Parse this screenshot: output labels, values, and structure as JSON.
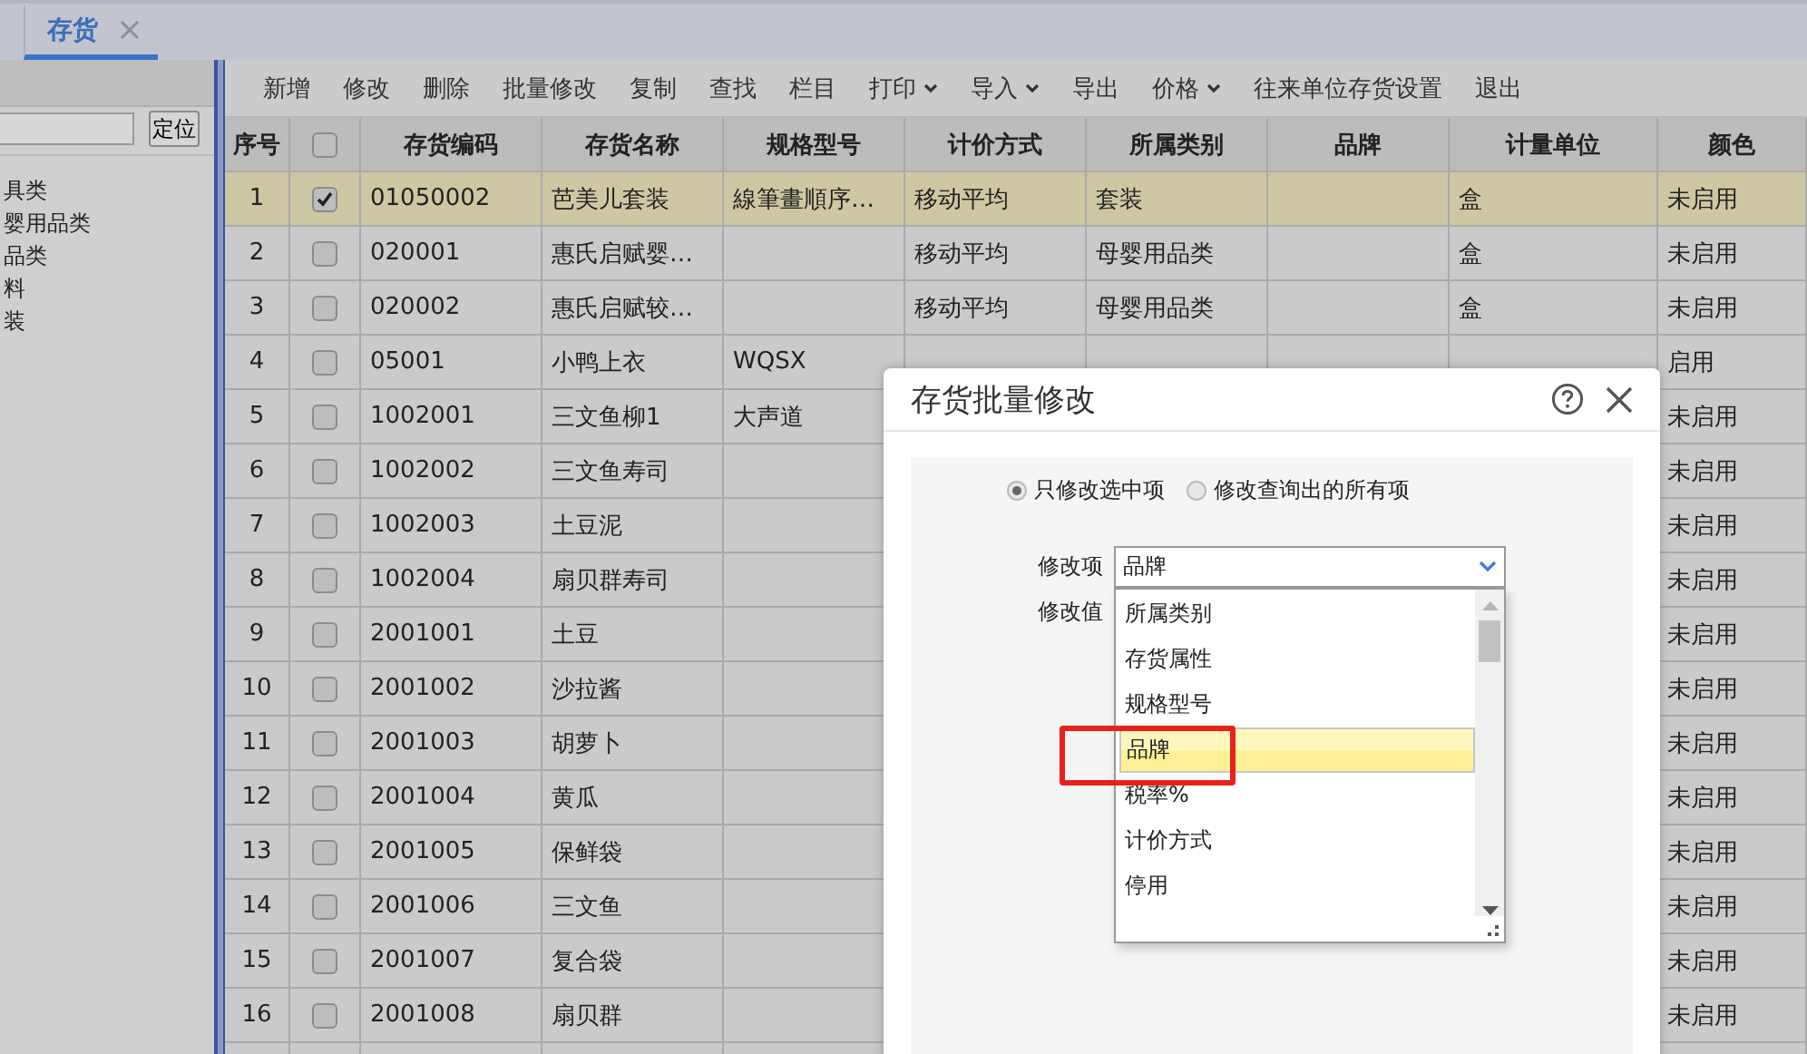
{
  "tabs": [
    {
      "label": "存货",
      "selected": true
    }
  ],
  "sidebar": {
    "locate_button": "定位",
    "tree_items": [
      "具类",
      "婴用品类",
      "品类",
      "料",
      "装"
    ]
  },
  "toolbar": [
    {
      "label": "新增",
      "dropdown": false
    },
    {
      "label": "修改",
      "dropdown": false
    },
    {
      "label": "删除",
      "dropdown": false
    },
    {
      "label": "批量修改",
      "dropdown": false
    },
    {
      "label": "复制",
      "dropdown": false
    },
    {
      "label": "查找",
      "dropdown": false
    },
    {
      "label": "栏目",
      "dropdown": false
    },
    {
      "label": "打印",
      "dropdown": true
    },
    {
      "label": "导入",
      "dropdown": true
    },
    {
      "label": "导出",
      "dropdown": false
    },
    {
      "label": "价格",
      "dropdown": true
    },
    {
      "label": "往来单位存货设置",
      "dropdown": false
    },
    {
      "label": "退出",
      "dropdown": false
    }
  ],
  "table": {
    "all_checked": false,
    "columns": [
      "序号",
      "存货编码",
      "存货名称",
      "规格型号",
      "计价方式",
      "所属类别",
      "品牌",
      "计量单位",
      "颜色"
    ],
    "rows": [
      {
        "no": "1",
        "checked": true,
        "selected": true,
        "code": "01050002",
        "name": "芭美儿套装",
        "spec": "線筆畫順序…",
        "pricing": "移动平均",
        "category": "套装",
        "unit": "盒",
        "color_setting": "未启用"
      },
      {
        "no": "2",
        "checked": false,
        "selected": false,
        "code": "020001",
        "name": "惠氏启赋婴…",
        "pricing": "移动平均",
        "category": "母婴用品类",
        "unit": "盒",
        "color_setting": "未启用"
      },
      {
        "no": "3",
        "checked": false,
        "selected": false,
        "code": "020002",
        "name": "惠氏启赋较…",
        "pricing": "移动平均",
        "category": "母婴用品类",
        "unit": "盒",
        "color_setting": "未启用"
      },
      {
        "no": "4",
        "checked": false,
        "selected": false,
        "code": "05001",
        "name": "小鸭上衣",
        "spec": "WQSX",
        "color_setting": "启用"
      },
      {
        "no": "5",
        "checked": false,
        "selected": false,
        "code": "1002001",
        "name": "三文鱼柳1",
        "spec": "大声道",
        "color_setting": "未启用"
      },
      {
        "no": "6",
        "checked": false,
        "selected": false,
        "code": "1002002",
        "name": "三文鱼寿司",
        "color_setting": "未启用"
      },
      {
        "no": "7",
        "checked": false,
        "selected": false,
        "code": "1002003",
        "name": "土豆泥",
        "color_setting": "未启用"
      },
      {
        "no": "8",
        "checked": false,
        "selected": false,
        "code": "1002004",
        "name": "扇贝群寿司",
        "color_setting": "未启用"
      },
      {
        "no": "9",
        "checked": false,
        "selected": false,
        "code": "2001001",
        "name": "土豆",
        "color_setting": "未启用"
      },
      {
        "no": "10",
        "checked": false,
        "selected": false,
        "code": "2001002",
        "name": "沙拉酱",
        "color_setting": "未启用"
      },
      {
        "no": "11",
        "checked": false,
        "selected": false,
        "code": "2001003",
        "name": "胡萝卜",
        "color_setting": "未启用"
      },
      {
        "no": "12",
        "checked": false,
        "selected": false,
        "code": "2001004",
        "name": "黄瓜",
        "color_setting": "未启用"
      },
      {
        "no": "13",
        "checked": false,
        "selected": false,
        "code": "2001005",
        "name": "保鲜袋",
        "color_setting": "未启用"
      },
      {
        "no": "14",
        "checked": false,
        "selected": false,
        "code": "2001006",
        "name": "三文鱼",
        "color_setting": "未启用"
      },
      {
        "no": "15",
        "checked": false,
        "selected": false,
        "code": "2001007",
        "name": "复合袋",
        "color_setting": "未启用"
      },
      {
        "no": "16",
        "checked": false,
        "selected": false,
        "code": "2001008",
        "name": "扇贝群",
        "color_setting": "未启用"
      }
    ]
  },
  "dialog": {
    "title": "存货批量修改",
    "scope": [
      {
        "label": "只修改选中项",
        "selected": true
      },
      {
        "label": "修改查询出的所有项",
        "selected": false
      }
    ],
    "field_label": "修改项",
    "field_value": "品牌",
    "value_label": "修改值",
    "options": [
      {
        "label": "所属类别",
        "selected": false
      },
      {
        "label": "存货属性",
        "selected": false
      },
      {
        "label": "规格型号",
        "selected": false
      },
      {
        "label": "品牌",
        "selected": true
      },
      {
        "label": "税率%",
        "selected": false
      },
      {
        "label": "计价方式",
        "selected": false
      },
      {
        "label": "停用",
        "selected": false
      }
    ]
  }
}
